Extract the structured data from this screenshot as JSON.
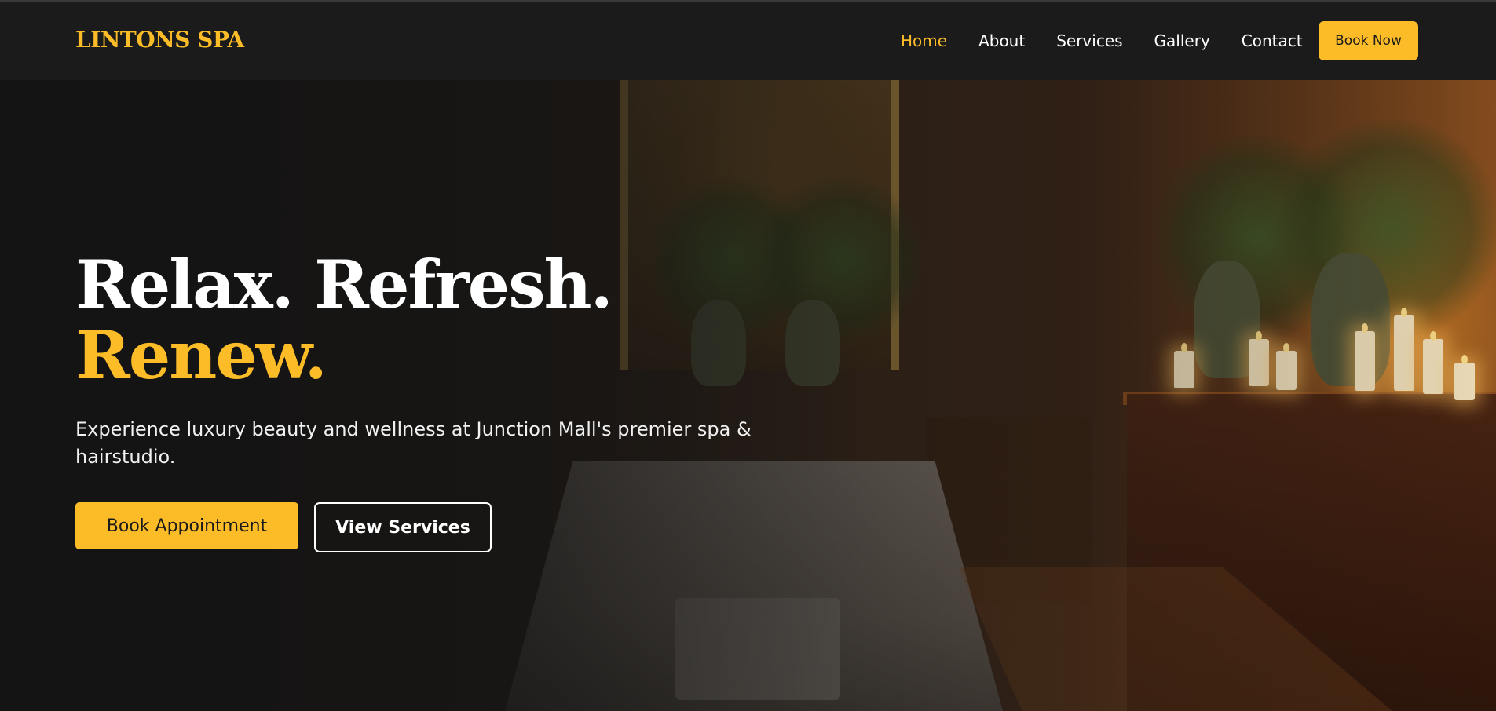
{
  "brand": {
    "name": "LINTONS SPA",
    "accent_color": "#fbbc28"
  },
  "nav": {
    "links": [
      {
        "label": "Home",
        "active": true
      },
      {
        "label": "About",
        "active": false
      },
      {
        "label": "Services",
        "active": false
      },
      {
        "label": "Gallery",
        "active": false
      },
      {
        "label": "Contact",
        "active": false
      }
    ],
    "cta_label": "Book Now"
  },
  "hero": {
    "headline": "Relax. Refresh.",
    "headline_accent": "Renew.",
    "subtext": "Experience luxury beauty and wellness at Junction Mall's premier spa & hairstudio.",
    "primary_button": "Book Appointment",
    "secondary_button": "View Services",
    "background_image": "spa-treatment-room"
  },
  "colors": {
    "background": "#1b1b1b",
    "text": "#ffffff",
    "accent": "#fbbc28"
  }
}
